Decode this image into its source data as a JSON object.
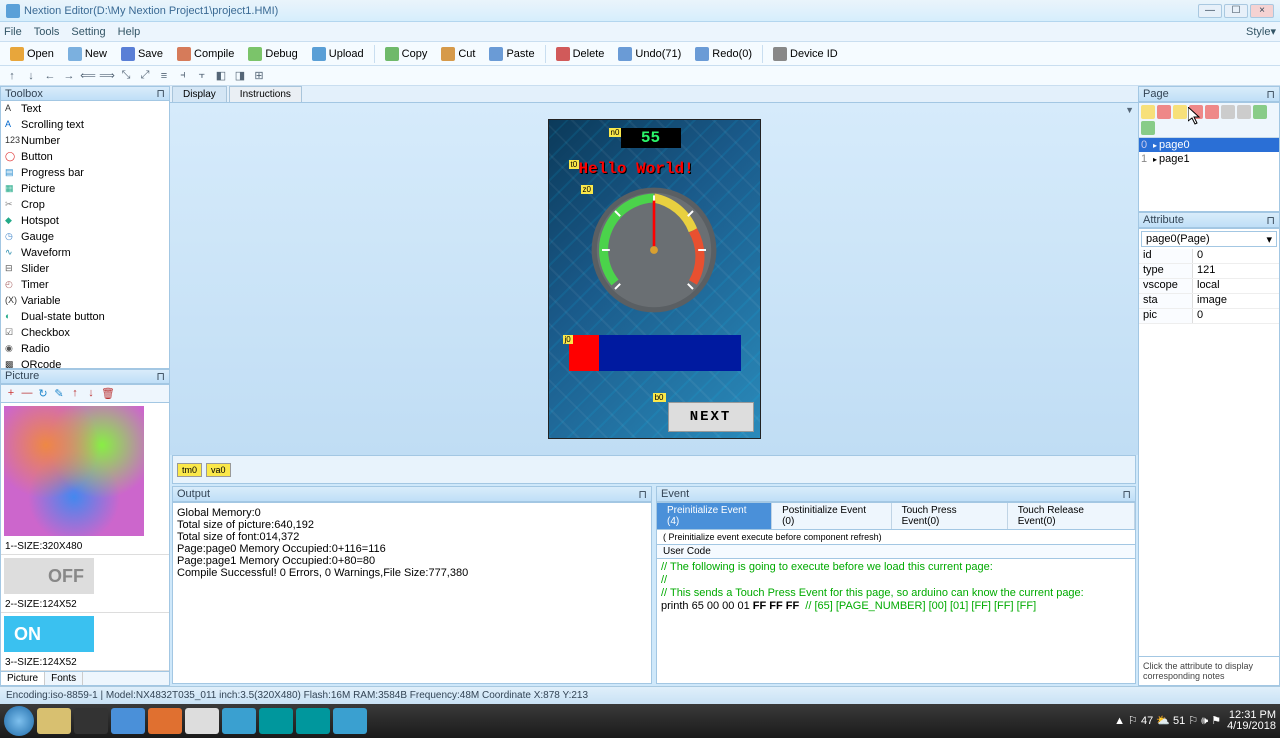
{
  "title": "Nextion Editor(D:\\My Nextion Project1\\project1.HMI)",
  "win": {
    "min": "—",
    "max": "☐",
    "close": "×"
  },
  "menu": [
    "File",
    "Tools",
    "Setting",
    "Help"
  ],
  "style_label": "Style▾",
  "toolbar1": [
    {
      "label": "Open",
      "color": "#e8a63b"
    },
    {
      "label": "New",
      "color": "#7bb0df"
    },
    {
      "label": "Save",
      "color": "#5a7fd6"
    },
    {
      "label": "Compile",
      "color": "#d67b5a"
    },
    {
      "label": "Debug",
      "color": "#7bc46a"
    },
    {
      "label": "Upload",
      "color": "#5a9fd6"
    },
    {
      "sep": true
    },
    {
      "label": "Copy",
      "color": "#6fb96a"
    },
    {
      "label": "Cut",
      "color": "#d69a4a"
    },
    {
      "label": "Paste",
      "color": "#6a9bd6"
    },
    {
      "sep": true
    },
    {
      "label": "Delete",
      "color": "#d15a5a"
    },
    {
      "label": "Undo(71)",
      "color": "#6a9bd6"
    },
    {
      "label": "Redo(0)",
      "color": "#6a9bd6"
    },
    {
      "sep": true
    },
    {
      "label": "Device ID",
      "color": "#888"
    }
  ],
  "toolbar2_glyphs": [
    "↑",
    "↓",
    "←",
    "→",
    "⟸",
    "⟹",
    "⤡",
    "⤢",
    "≡",
    "⫞",
    "⫟",
    "◧",
    "◨",
    "⊞"
  ],
  "toolbox_title": "Toolbox",
  "toolbox_items": [
    {
      "label": "Text",
      "icon": "A",
      "c": "#333"
    },
    {
      "label": "Scrolling text",
      "icon": "A",
      "c": "#06c"
    },
    {
      "label": "Number",
      "icon": "123",
      "c": "#333"
    },
    {
      "label": "Button",
      "icon": "◯",
      "c": "#d22"
    },
    {
      "label": "Progress bar",
      "icon": "▤",
      "c": "#28c"
    },
    {
      "label": "Picture",
      "icon": "▦",
      "c": "#2a8"
    },
    {
      "label": "Crop",
      "icon": "✂",
      "c": "#888"
    },
    {
      "label": "Hotspot",
      "icon": "◆",
      "c": "#2a8"
    },
    {
      "label": "Gauge",
      "icon": "◷",
      "c": "#48c"
    },
    {
      "label": "Waveform",
      "icon": "∿",
      "c": "#28a"
    },
    {
      "label": "Slider",
      "icon": "⊟",
      "c": "#555"
    },
    {
      "label": "Timer",
      "icon": "◴",
      "c": "#a66"
    },
    {
      "label": "Variable",
      "icon": "(X)",
      "c": "#333"
    },
    {
      "label": "Dual-state button",
      "icon": "◐",
      "c": "#2a8"
    },
    {
      "label": "Checkbox",
      "icon": "☑",
      "c": "#555"
    },
    {
      "label": "Radio",
      "icon": "◉",
      "c": "#555"
    },
    {
      "label": "QRcode",
      "icon": "▩",
      "c": "#333"
    }
  ],
  "picture_title": "Picture",
  "picbar_icons": [
    "+",
    "—",
    "↻",
    "✎",
    "↑",
    "↓",
    "🗑"
  ],
  "pictures": [
    {
      "label": "1--SIZE:320X480",
      "type": "color"
    },
    {
      "label": "2--SIZE:124X52",
      "type": "off",
      "txt": "OFF"
    },
    {
      "label": "3--SIZE:124X52",
      "type": "on",
      "txt": "ON"
    }
  ],
  "pictabs": [
    "Picture",
    "Fonts"
  ],
  "center_tabs": [
    "Display",
    "Instructions"
  ],
  "canvas": {
    "num_value": "55",
    "hello": "Hello World!",
    "next": "NEXT",
    "badges": {
      "n0": "n0",
      "t0": "t0",
      "z0": "z0",
      "j0": "j0",
      "b0": "b0"
    }
  },
  "var_chips": [
    "tm0",
    "va0"
  ],
  "output_title": "Output",
  "output_lines": [
    "Global Memory:0",
    "Total size of picture:640,192",
    "Total size of font:014,372",
    "Page:page0 Memory Occupied:0+116=116",
    "Page:page1 Memory Occupied:0+80=80",
    "Compile Successful! 0 Errors, 0 Warnings,File Size:777,380"
  ],
  "event_title": "Event",
  "event_tabs": [
    {
      "label": "Preinitialize Event (4)",
      "active": true
    },
    {
      "label": "Postinitialize Event (0)"
    },
    {
      "label": "Touch Press Event(0)"
    },
    {
      "label": "Touch Release Event(0)"
    }
  ],
  "event_hint": "( Preinitialize event execute before component refresh)",
  "event_label": "User Code",
  "event_code": {
    "l1": "// The following is going to execute before we load this current page:",
    "l2": "//",
    "l3": "// This sends a Touch Press Event for this page, so arduino can know the current page:",
    "l4a": "printh 65 00 00 01 ",
    "l4b": "FF FF FF",
    "l4c": "  // [65] [PAGE_NUMBER] [00] [01] [FF] [FF] [FF]"
  },
  "page_title": "Page",
  "pages": [
    {
      "idx": "0",
      "label": "page0",
      "sel": true
    },
    {
      "idx": "1",
      "label": "page1"
    }
  ],
  "attr_title": "Attribute",
  "attr_dropdown": "page0(Page)",
  "attrs": [
    {
      "k": "id",
      "v": "0"
    },
    {
      "k": "type",
      "v": "121"
    },
    {
      "k": "vscope",
      "v": "local"
    },
    {
      "k": "sta",
      "v": "image"
    },
    {
      "k": "pic",
      "v": "0"
    }
  ],
  "attr_note": "Click the attribute to display corresponding notes",
  "status": "Encoding:iso-8859-1 | Model:NX4832T035_011  inch:3.5(320X480) Flash:16M RAM:3584B Frequency:48M    Coordinate X:878  Y:213",
  "tray": {
    "icons": "▲ ⚐ 47 ⛅ 51 ⚐ 🕪 ⚑",
    "time": "12:31 PM",
    "date": "4/19/2018"
  }
}
